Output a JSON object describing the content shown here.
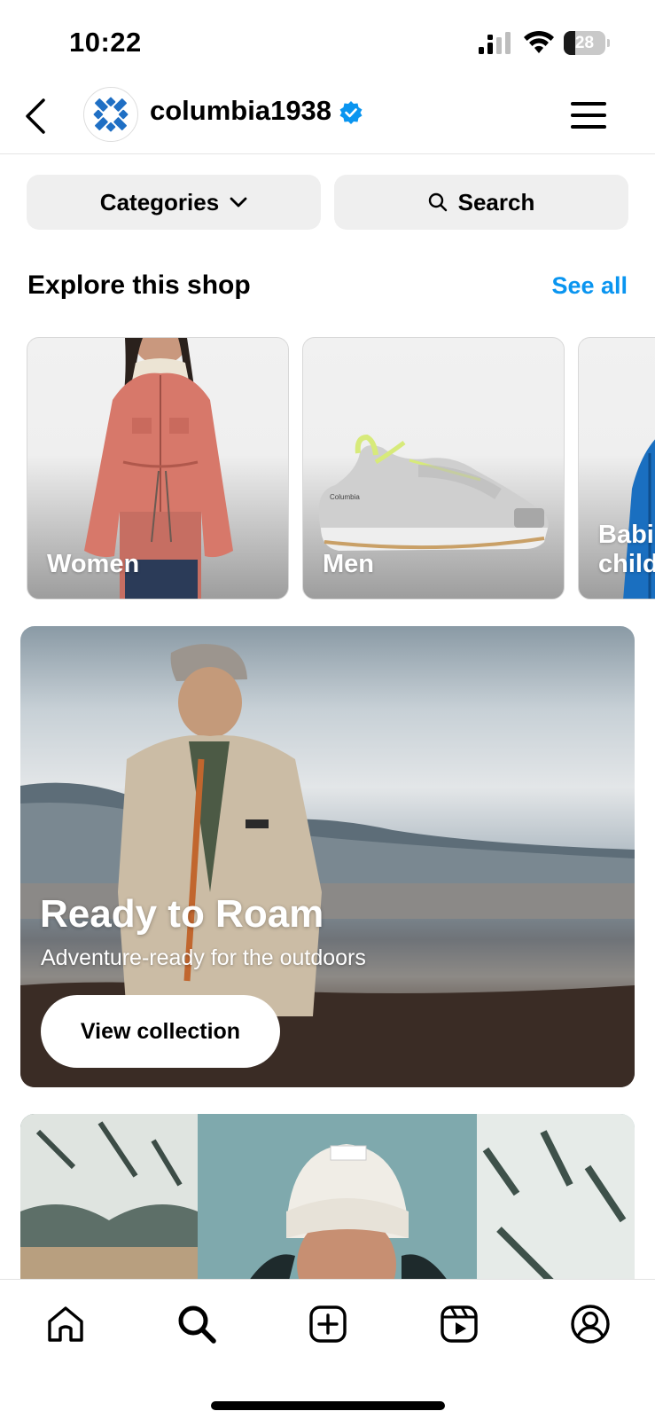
{
  "status_bar": {
    "time": "10:22",
    "battery": "28",
    "battery_level_percent": 28
  },
  "header": {
    "username": "columbia1938",
    "verified": true
  },
  "actions": {
    "categories_label": "Categories",
    "search_label": "Search"
  },
  "explore": {
    "title": "Explore this shop",
    "see_all": "See all",
    "cards": [
      {
        "label": "Women"
      },
      {
        "label": "Men"
      },
      {
        "label": "Babi\nchild"
      }
    ]
  },
  "banner": {
    "title": "Ready to Roam",
    "subtitle": "Adventure-ready for the outdoors",
    "button": "View collection"
  },
  "colors": {
    "accent": "#0a95f0",
    "brand_blue": "#1f6fc4"
  },
  "nav": {
    "icons": [
      "home-icon",
      "search-icon",
      "create-icon",
      "reels-icon",
      "profile-icon"
    ],
    "active": "search-icon"
  }
}
